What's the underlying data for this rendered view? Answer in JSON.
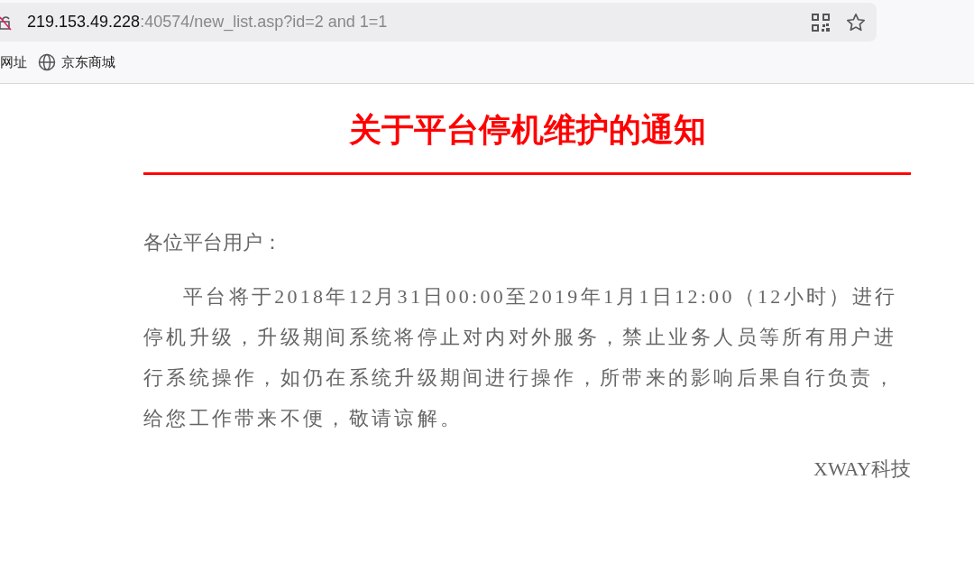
{
  "address_bar": {
    "host": "219.153.49.228",
    "rest": ":40574/new_list.asp?id=2 and 1=1"
  },
  "bookmarks": [
    {
      "label": "网址",
      "icon": false
    },
    {
      "label": "京东商城",
      "icon": true
    }
  ],
  "page": {
    "title": "关于平台停机维护的通知",
    "greeting": "各位平台用户：",
    "paragraph": "平台将于2018年12月31日00:00至2019年1月1日12:00（12小时）进行停机升级，升级期间系统将停止对内对外服务，禁止业务人员等所有用户进行系统操作，如仍在系统升级期间进行操作，所带来的影响后果自行负责，给您工作带来不便，敬请谅解。",
    "signature": "XWAY科技"
  }
}
